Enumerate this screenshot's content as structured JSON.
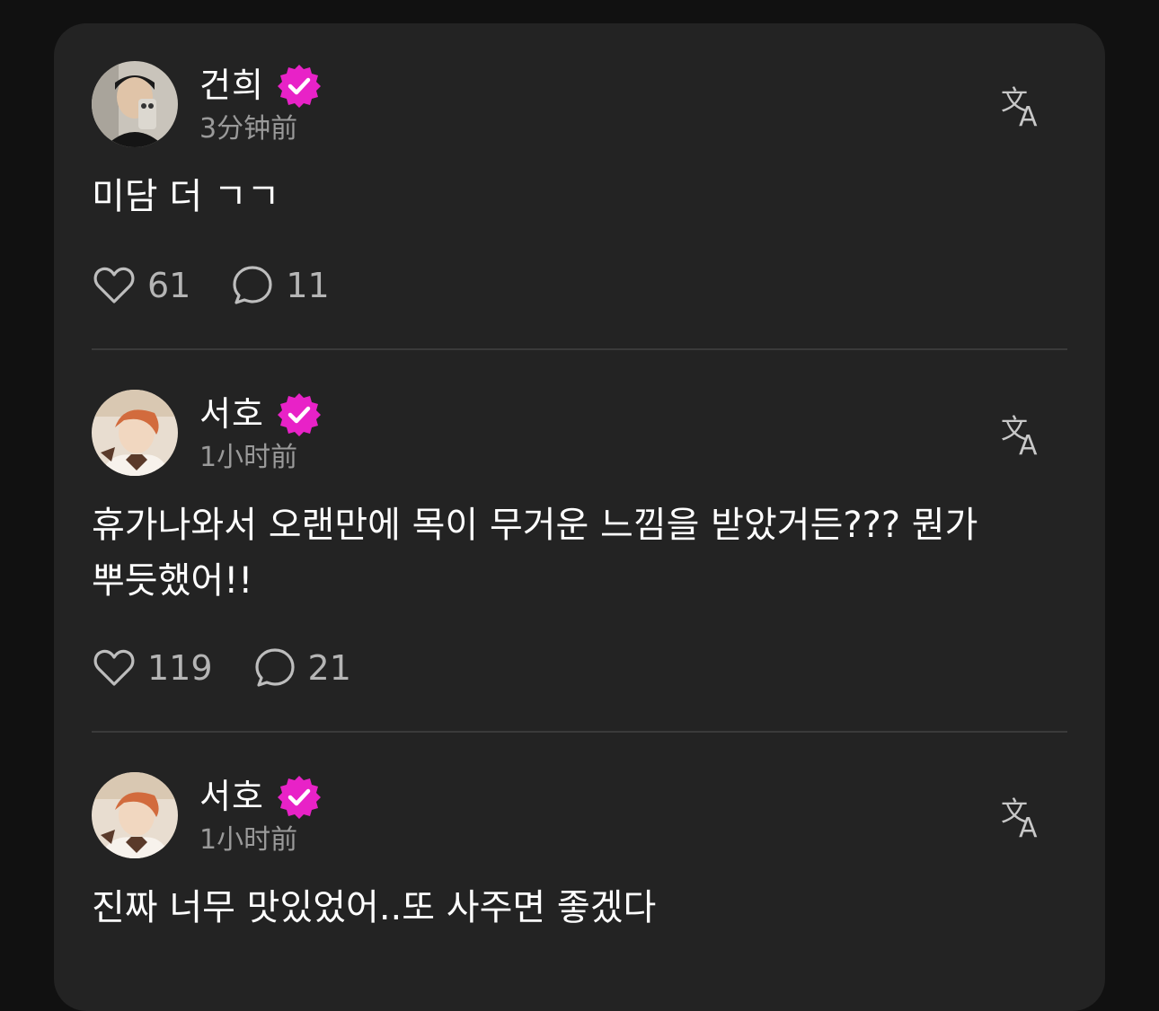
{
  "colors": {
    "background": "#111111",
    "card": "#232323",
    "badge": "#e822c7",
    "muted": "#9a9a9a"
  },
  "posts": [
    {
      "author": "건희",
      "time": "3分钟前",
      "text": "미담 더 ㄱㄱ",
      "likes": "61",
      "comments": "11",
      "verified": true
    },
    {
      "author": "서호",
      "time": "1小时前",
      "text": "휴가나와서 오랜만에 목이 무거운 느낌을 받았거든??? 뭔가 뿌듯했어!!",
      "likes": "119",
      "comments": "21",
      "verified": true
    },
    {
      "author": "서호",
      "time": "1小时前",
      "text": "진짜 너무 맛있었어..또 사주면 좋겠다",
      "verified": true
    }
  ],
  "icons": {
    "like": "heart-icon",
    "comment": "comment-bubble-icon",
    "translate": "translate-icon",
    "verified": "verified-badge-icon"
  }
}
